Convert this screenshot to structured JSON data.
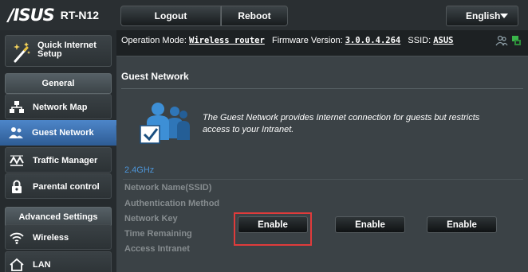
{
  "header": {
    "brand": "/ISUS",
    "model": "RT-N12",
    "logout_label": "Logout",
    "reboot_label": "Reboot",
    "language": "English"
  },
  "sidebar": {
    "quick_setup_label": "Quick Internet Setup",
    "general_label": "General",
    "general_items": [
      {
        "label": "Network Map",
        "icon": "network-map-icon"
      },
      {
        "label": "Guest Network",
        "icon": "guest-network-icon",
        "active": true
      },
      {
        "label": "Traffic Manager",
        "icon": "traffic-manager-icon"
      },
      {
        "label": "Parental control",
        "icon": "parental-control-icon"
      }
    ],
    "advanced_label": "Advanced Settings",
    "advanced_items": [
      {
        "label": "Wireless",
        "icon": "wireless-icon"
      },
      {
        "label": "LAN",
        "icon": "lan-icon"
      }
    ]
  },
  "status": {
    "operation_mode_label": "Operation Mode:",
    "operation_mode_value": "Wireless router",
    "firmware_label": "Firmware Version:",
    "firmware_value": "3.0.0.4.264",
    "ssid_label": "SSID:",
    "ssid_value": "ASUS"
  },
  "main": {
    "title": "Guest Network",
    "description": "The Guest Network provides Internet connection for guests but restricts access to your Intranet.",
    "band": "2.4GHz",
    "row_labels": [
      "Network Name(SSID)",
      "Authentication Method",
      "Network Key",
      "Time Remaining",
      "Access Intranet"
    ],
    "enable_buttons": [
      "Enable",
      "Enable",
      "Enable"
    ]
  },
  "colors": {
    "active_nav": "#3a6ea9",
    "band_text": "#4d94d6",
    "highlight": "#e03b3b",
    "usb_icon": "#3ab54a"
  }
}
